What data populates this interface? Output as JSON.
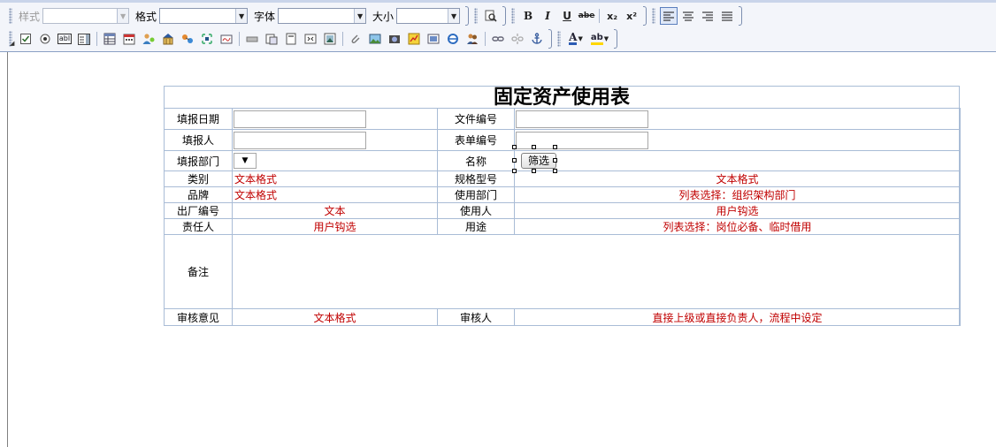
{
  "toolbar": {
    "style_label": "样式",
    "format_label": "格式",
    "font_label": "字体",
    "size_label": "大小",
    "bold": "B",
    "italic": "I",
    "underline": "U",
    "strike": "abe",
    "subscript": "x₂",
    "superscript": "x²",
    "font_color_glyph": "A",
    "bg_color_glyph": "ab",
    "form_text_glyph": "abl",
    "icons": [
      "checkbox-icon",
      "radio-icon",
      "textbox-icon",
      "listbox-icon",
      "table-icon",
      "date-icon",
      "user-icon",
      "department-icon",
      "link-field-icon",
      "macro-icon",
      "sign-icon",
      "button-icon",
      "hidden-field-icon",
      "page-icon",
      "frame-icon",
      "image-field-icon",
      "attachment-icon",
      "picture-icon",
      "camera-icon",
      "chart-icon",
      "flash-icon",
      "ie-icon",
      "user-group-icon",
      "hyperlink-icon",
      "unlink-icon",
      "anchor-icon",
      "font-color-icon",
      "highlight-icon"
    ]
  },
  "form": {
    "title": "固定资产使用表",
    "rows": [
      {
        "l1": "填报日期",
        "l2": "文件编号"
      },
      {
        "l1": "填报人",
        "l2": "表单编号"
      },
      {
        "l1": "填报部门",
        "l2": "名称",
        "filter_button": "筛选"
      },
      {
        "l1": "类别",
        "v1": "文本格式",
        "l2": "规格型号",
        "v2": "文本格式"
      },
      {
        "l1": "品牌",
        "v1": "文本格式",
        "l2": "使用部门",
        "v2": "列表选择：组织架构部门"
      },
      {
        "l1": "出厂编号",
        "v1": "文本",
        "l2": "使用人",
        "v2": "用户钩选"
      },
      {
        "l1": "责任人",
        "v1": "用户钩选",
        "l2": "用途",
        "v2": "列表选择：岗位必备、临时借用"
      },
      {
        "l1": "备注"
      },
      {
        "l1": "审核意见",
        "v1": "文本格式",
        "l2": "审核人",
        "v2": "直接上级或直接负责人，流程中设定"
      }
    ]
  },
  "colors": {
    "red_text": "#c00000",
    "border": "#a9bcd6",
    "toolbar_bg": "#f3f5fa"
  }
}
